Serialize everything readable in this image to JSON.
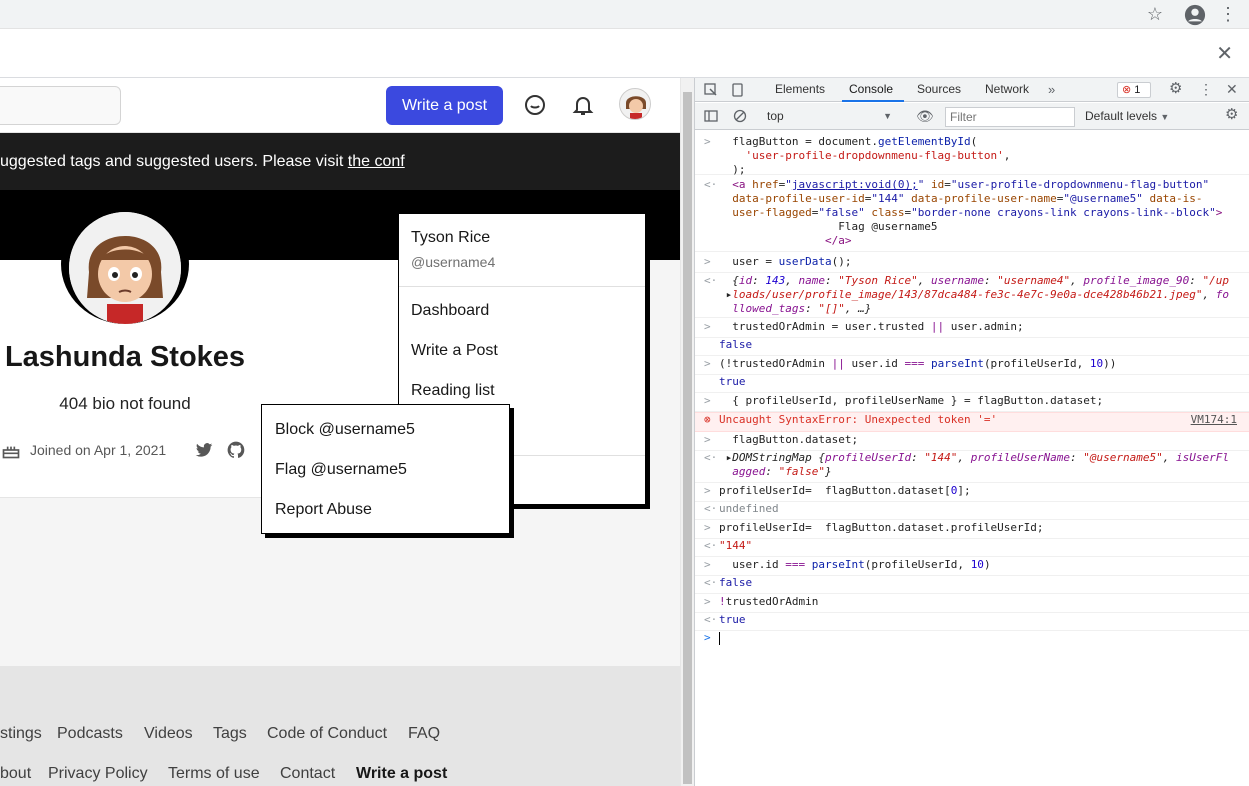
{
  "page": {
    "header": {
      "write_post": "Write a post"
    },
    "banner": {
      "text": "uggested tags and suggested users. Please visit ",
      "link": "the conf"
    },
    "profile": {
      "name": "Lashunda Stokes",
      "bio": "404 bio not found",
      "joined": "Joined on Apr 1, 2021"
    },
    "footer": {
      "row1": [
        "stings",
        "Podcasts",
        "Videos",
        "Tags",
        "Code of Conduct",
        "FAQ"
      ],
      "row2": [
        "bout",
        "Privacy Policy",
        "Terms of use",
        "Contact",
        "Write a post"
      ]
    },
    "user_menu": {
      "name": "Tyson Rice",
      "handle": "@username4",
      "items": [
        "Dashboard",
        "Write a Post",
        "Reading list"
      ]
    },
    "profile_menu": {
      "items": [
        "Block @username5",
        "Flag @username5",
        "Report Abuse"
      ]
    }
  },
  "devtools": {
    "tabs": [
      "Elements",
      "Console",
      "Sources",
      "Network"
    ],
    "active_tab": "Console",
    "error_count": "1",
    "context": "top",
    "filter_placeholder": "Filter",
    "levels": "Default levels",
    "error_source": "VM174:1"
  },
  "icons": {
    "star": "star-icon",
    "profile": "account-circle-icon",
    "menu": "kebab-menu-icon",
    "close": "close-icon",
    "chat": "chat-icon",
    "bell": "bell-icon",
    "twitter": "twitter-icon",
    "github": "github-icon",
    "cake": "cake-icon"
  },
  "colors": {
    "accent": "#3b49df",
    "banner_bg": "#1c1c1c",
    "error": "#d93025"
  }
}
